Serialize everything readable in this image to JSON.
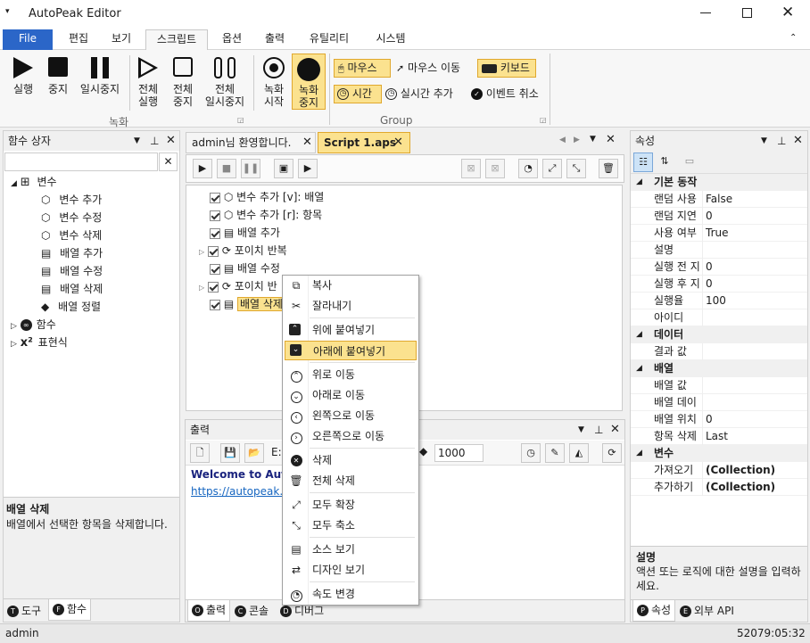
{
  "app": {
    "title": "AutoPeak Editor",
    "system_menu_icon": "menu-down-icon"
  },
  "ribbon_tabs": [
    "File",
    "편집",
    "보기",
    "스크립트",
    "옵션",
    "출력",
    "유틸리티",
    "시스템"
  ],
  "ribbon": {
    "record_group": {
      "label": "녹화",
      "record": "실행",
      "stop": "중지",
      "pause": "일시중지",
      "run_all": "전체\n실행",
      "stop_all": "전체\n중지",
      "pause_all": "전체\n일시중지",
      "rec_start": "녹화\n시작",
      "rec_stop": "녹화\n중지"
    },
    "group": {
      "label": "Group",
      "mouse": "마우스",
      "mouse_move": "마우스 이동",
      "keyboard": "키보드",
      "time": "시간",
      "realtime_add": "실시간 추가",
      "event_cancel": "이벤트 취소"
    }
  },
  "left_panel": {
    "title": "함수 상자",
    "tree": {
      "variables": "변수",
      "var_add": "변수 추가",
      "var_edit": "변수 수정",
      "var_delete": "변수 삭제",
      "arr_add": "배열 추가",
      "arr_edit": "배열 수정",
      "arr_delete": "배열 삭제",
      "arr_sort": "배열 정렬",
      "functions": "함수",
      "expressions": "표현식"
    },
    "desc_title": "배열 삭제",
    "desc_text": "배열에서 선택한 항목을 삭제합니다.",
    "tabs": [
      "도구",
      "함수"
    ]
  },
  "doc_tabs": [
    "admin님 환영합니다.",
    "Script 1.aps"
  ],
  "script_lines": [
    "변수 추가 [v]: 배열",
    "변수 추가 [r]: 항목",
    "배열 추가",
    "포이치 반복",
    "배열 수정",
    "포이치 반",
    "배열 삭제"
  ],
  "output": {
    "title": "출력",
    "speed": "1000",
    "welcome": "Welcome to AutoP",
    "link": "https://autopeak.",
    "file_prefix": "E:"
  },
  "bottom_tabs": [
    "출력",
    "콘솔",
    "디버그"
  ],
  "context_menu": [
    "복사",
    "잘라내기",
    "위에 붙여넣기",
    "아래에 붙여넣기",
    "위로 이동",
    "아래로 이동",
    "왼쪽으로 이동",
    "오른쪽으로 이동",
    "삭제",
    "전체 삭제",
    "모두 확장",
    "모두 축소",
    "소스 보기",
    "디자인 보기",
    "속도 변경"
  ],
  "properties": {
    "title": "속성",
    "categories": {
      "basic": "기본 동작",
      "data": "데이터",
      "array": "배열",
      "variable": "변수"
    },
    "basic": [
      [
        "랜덤 사용",
        "False"
      ],
      [
        "랜덤 지연",
        "0"
      ],
      [
        "사용 여부",
        "True"
      ],
      [
        "설명",
        ""
      ],
      [
        "실행 전 지",
        "0"
      ],
      [
        "실행 후 지",
        "0"
      ],
      [
        "실행율",
        "100"
      ],
      [
        "아이디",
        ""
      ]
    ],
    "data": [
      [
        "결과 값",
        ""
      ]
    ],
    "array": [
      [
        "배열 값",
        ""
      ],
      [
        "배열 데이",
        ""
      ],
      [
        "배열 위치",
        "0"
      ],
      [
        "항목 삭제",
        "Last"
      ]
    ],
    "variable": [
      [
        "가져오기",
        "(Collection)"
      ],
      [
        "추가하기",
        "(Collection)"
      ]
    ],
    "desc_title": "설명",
    "desc_text": "액션 또는 로직에 대한 설명을 입력하세요.",
    "tabs": [
      "속성",
      "외부 API"
    ]
  },
  "status": {
    "user": "admin",
    "time": "52079:05:32"
  },
  "colors": {
    "accent": "#2b66c8",
    "highlight": "#fbe28f",
    "highlight_border": "#e0a82e"
  }
}
